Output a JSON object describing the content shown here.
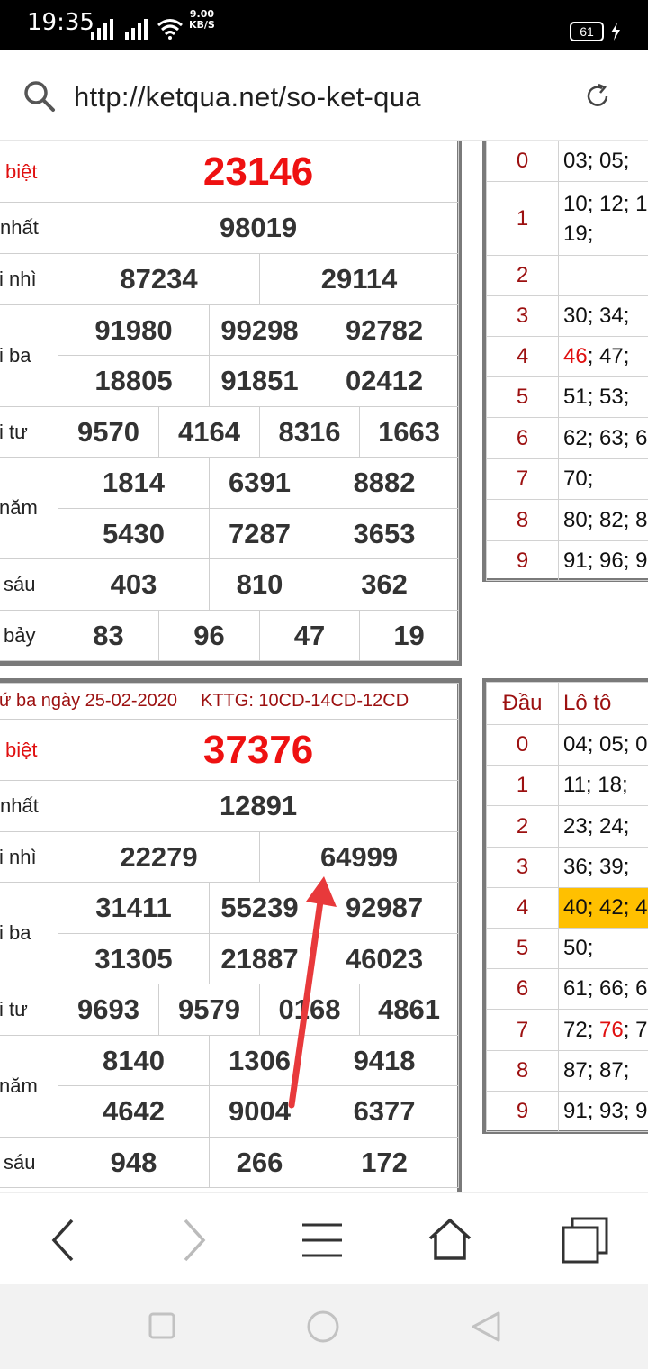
{
  "status": {
    "time": "19:35",
    "net_speed_value": "9.00",
    "net_speed_unit": "KB/S",
    "battery": "61"
  },
  "browser": {
    "url": "http://ketqua.net/so-ket-qua"
  },
  "top_result": {
    "rows": [
      {
        "label": "biệt",
        "values": [
          "23146"
        ]
      },
      {
        "label": "nhất",
        "values": [
          "98019"
        ]
      },
      {
        "label": "i nhì",
        "values": [
          "87234",
          "29114"
        ]
      },
      {
        "label": "i ba",
        "values": [
          "91980",
          "99298",
          "92782",
          "18805",
          "91851",
          "02412"
        ]
      },
      {
        "label": "i tư",
        "values": [
          "9570",
          "4164",
          "8316",
          "1663"
        ]
      },
      {
        "label": "năm",
        "values": [
          "1814",
          "6391",
          "8882",
          "5430",
          "7287",
          "3653"
        ]
      },
      {
        "label": "sáu",
        "values": [
          "403",
          "810",
          "362"
        ]
      },
      {
        "label": "bảy",
        "values": [
          "83",
          "96",
          "47",
          "19"
        ]
      }
    ]
  },
  "top_loto": {
    "rows": [
      {
        "dau": "0",
        "loto": "03; 05;"
      },
      {
        "dau": "1",
        "loto": "10; 12; 1",
        "loto2": "19;"
      },
      {
        "dau": "2",
        "loto": ""
      },
      {
        "dau": "3",
        "loto": "30; 34;"
      },
      {
        "dau": "4",
        "loto_red": "46",
        "loto": "; 47;"
      },
      {
        "dau": "5",
        "loto": "51; 53;"
      },
      {
        "dau": "6",
        "loto": "62; 63; 6"
      },
      {
        "dau": "7",
        "loto": "70;"
      },
      {
        "dau": "8",
        "loto": "80; 82; 8"
      },
      {
        "dau": "9",
        "loto": "91; 96; 9"
      }
    ]
  },
  "bottom_result": {
    "header_date": "ứ ba ngày 25-02-2020",
    "header_kttg": "KTTG: 10CD-14CD-12CD",
    "rows": [
      {
        "label": "biệt",
        "values": [
          "37376"
        ]
      },
      {
        "label": "nhất",
        "values": [
          "12891"
        ]
      },
      {
        "label": "i nhì",
        "values": [
          "22279",
          "64999"
        ]
      },
      {
        "label": "i ba",
        "values": [
          "31411",
          "55239",
          "92987",
          "31305",
          "21887",
          "46023"
        ]
      },
      {
        "label": "i tư",
        "values": [
          "9693",
          "9579",
          "0168",
          "4861"
        ]
      },
      {
        "label": "năm",
        "values": [
          "8140",
          "1306",
          "9418",
          "4642",
          "9004",
          "6377"
        ]
      },
      {
        "label": "sáu",
        "values": [
          "948",
          "266",
          "172"
        ]
      }
    ]
  },
  "bottom_loto": {
    "header_dau": "Đầu",
    "header_loto": "Lô tô",
    "rows": [
      {
        "dau": "0",
        "loto": "04; 05; 0"
      },
      {
        "dau": "1",
        "loto": "11; 18;"
      },
      {
        "dau": "2",
        "loto": "23; 24;"
      },
      {
        "dau": "3",
        "loto": "36; 39;"
      },
      {
        "dau": "4",
        "loto": "40; 42; 4"
      },
      {
        "dau": "5",
        "loto": "50;"
      },
      {
        "dau": "6",
        "loto": "61; 66; 6"
      },
      {
        "dau": "7",
        "loto": "72; ",
        "loto_red": "76",
        "loto_after": "; 7"
      },
      {
        "dau": "8",
        "loto": "87; 87;"
      },
      {
        "dau": "9",
        "loto": "91; 93; 9"
      }
    ]
  },
  "colors": {
    "special_prize": "#ee1111",
    "highlight": "#ffc000",
    "annotation_arrow": "#e8393b"
  },
  "icons": [
    "search-icon",
    "reload-icon",
    "back-icon",
    "forward-icon",
    "menu-icon",
    "home-icon",
    "tabs-icon",
    "square-icon",
    "circle-icon",
    "triangle-back-icon"
  ]
}
